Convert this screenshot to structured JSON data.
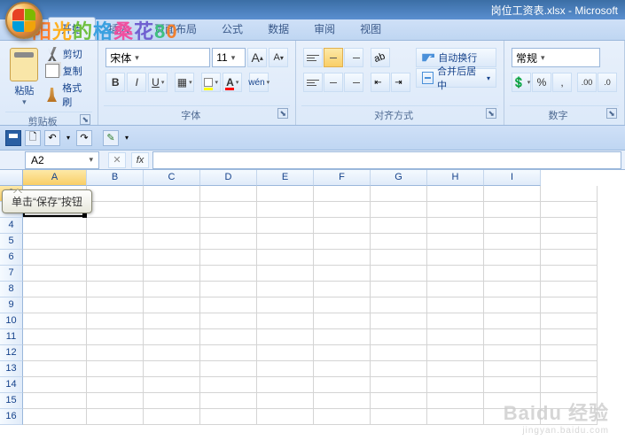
{
  "title": "岗位工资表.xlsx - Microsoft",
  "tabs": [
    "开始",
    "插入",
    "页面布局",
    "公式",
    "数据",
    "审阅",
    "视图"
  ],
  "active_tab": 0,
  "clipboard": {
    "paste": "粘贴",
    "cut": "剪切",
    "copy": "复制",
    "brush": "格式刷",
    "group": "剪贴板"
  },
  "font": {
    "name": "宋体",
    "size": "11",
    "group": "字体"
  },
  "align": {
    "wrap": "自动换行",
    "merge": "合并后居中",
    "group": "对齐方式"
  },
  "number": {
    "format": "常规",
    "group": "数字"
  },
  "namebox": "A2",
  "tooltip": "单击“保存”按钮",
  "cols": [
    "A",
    "B",
    "C",
    "D",
    "E",
    "F",
    "G",
    "H",
    "I"
  ],
  "rows": [
    2,
    3,
    4,
    5,
    6,
    7,
    8,
    9,
    10,
    11,
    12,
    13,
    14,
    15,
    16
  ],
  "selected_col": "A",
  "selected_row": 2,
  "watermark_main": "阳光的格桑花80",
  "watermark_baidu": "Baidu 经验",
  "watermark_baidu_sub": "jingyan.baidu.com"
}
